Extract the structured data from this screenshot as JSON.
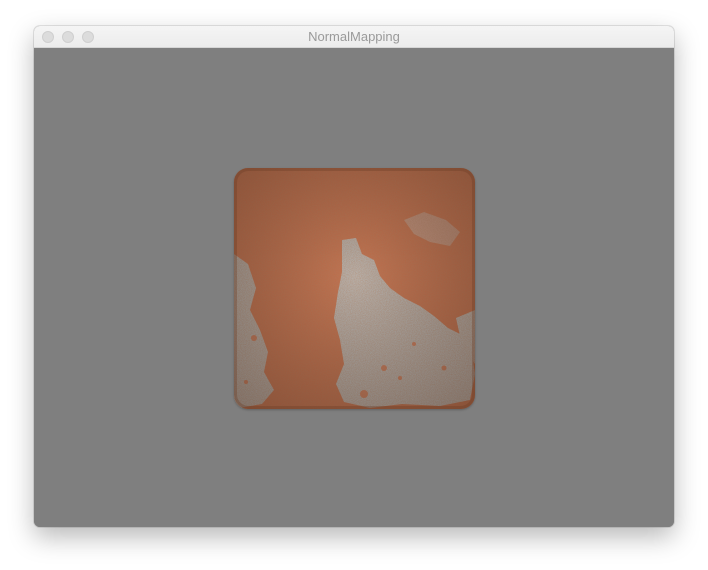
{
  "window": {
    "title": "NormalMapping"
  },
  "titlebar": {
    "buttons": [
      "close",
      "minimize",
      "zoom"
    ]
  },
  "viewport": {
    "clear_color": "#7f7f7f"
  },
  "tile": {
    "base_color": "#c4724f",
    "highlight_color": "#b7b2ad",
    "icon": "brick-tile-texture"
  }
}
